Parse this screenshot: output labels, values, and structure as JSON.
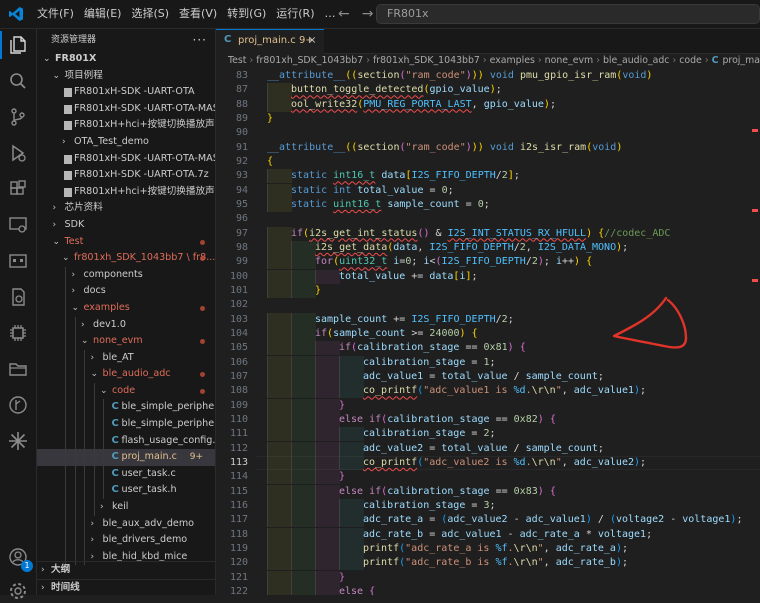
{
  "titlebar": {
    "menu": [
      "文件(F)",
      "编辑(E)",
      "选择(S)",
      "查看(V)",
      "转到(G)",
      "运行(R)",
      "…"
    ],
    "search_text": "FR801x"
  },
  "activity_bar": {
    "icons": [
      "explorer-icon",
      "search-icon",
      "source-control-icon",
      "run-debug-icon",
      "extensions-icon",
      "remote-explorer-icon",
      "terminal-icon",
      "testing-icon",
      "chip-icon",
      "folder-icon",
      "git-graph-icon",
      "sparkle-icon",
      "account-icon",
      "settings-icon"
    ],
    "badge": "1",
    "accent": "#0078d4"
  },
  "sidebar": {
    "title": "资源管理器",
    "more": "···",
    "tree": [
      {
        "label": "FR801X",
        "level": 0,
        "chev": "⌄",
        "bold": true
      },
      {
        "label": "项目例程",
        "level": 1,
        "chev": "⌄"
      },
      {
        "label": "FR801xH-SDK -UART-OTA",
        "level": 2,
        "icon": "file"
      },
      {
        "label": "FR801xH-SDK -UART-OTA-MAST...",
        "level": 2,
        "icon": "file"
      },
      {
        "label": "FR801xH+hci+按键切换播放声音",
        "level": 2,
        "icon": "file"
      },
      {
        "label": "OTA_Test_demo",
        "level": 2,
        "chev": "›"
      },
      {
        "label": "FR801xH-SDK -UART-OTA-MAST...",
        "level": 2,
        "icon": "file"
      },
      {
        "label": "FR801xH-SDK -UART-OTA.7z",
        "level": 2,
        "icon": "file"
      },
      {
        "label": "FR801xH+hci+按键切换播放声音...",
        "level": 2,
        "icon": "file"
      },
      {
        "label": "芯片资料",
        "level": 1,
        "chev": "›"
      },
      {
        "label": "SDK",
        "level": 1,
        "chev": "›"
      },
      {
        "label": "Test",
        "level": 1,
        "chev": "⌄",
        "color": "red",
        "dot": true
      },
      {
        "label": "fr801xh_SDK_1043bb7 \\ fr8...",
        "level": 2,
        "chev": "⌄",
        "color": "red",
        "dot": true
      },
      {
        "label": "components",
        "level": 3,
        "chev": "›"
      },
      {
        "label": "docs",
        "level": 3,
        "chev": "›"
      },
      {
        "label": "examples",
        "level": 3,
        "chev": "⌄",
        "color": "red",
        "dot": true
      },
      {
        "label": "dev1.0",
        "level": 4,
        "chev": "›"
      },
      {
        "label": "none_evm",
        "level": 4,
        "chev": "⌄",
        "color": "red",
        "dot": true
      },
      {
        "label": "ble_AT",
        "level": 5,
        "chev": "›"
      },
      {
        "label": "ble_audio_adc",
        "level": 5,
        "chev": "⌄",
        "color": "red",
        "dot": true
      },
      {
        "label": "code",
        "level": 6,
        "chev": "⌄",
        "color": "red",
        "dot": true
      },
      {
        "label": "ble_simple_peripheral.c",
        "level": 7,
        "icon": "c"
      },
      {
        "label": "ble_simple_peripheral.h",
        "level": 7,
        "icon": "c"
      },
      {
        "label": "flash_usage_config.h",
        "level": 7,
        "icon": "c"
      },
      {
        "label": "proj_main.c",
        "level": 7,
        "icon": "c",
        "color": "orange",
        "count": "9+",
        "selected": true
      },
      {
        "label": "user_task.c",
        "level": 7,
        "icon": "c"
      },
      {
        "label": "user_task.h",
        "level": 7,
        "icon": "c"
      },
      {
        "label": "keil",
        "level": 6,
        "chev": "›"
      },
      {
        "label": "ble_aux_adv_demo",
        "level": 5,
        "chev": "›"
      },
      {
        "label": "ble_drivers_demo",
        "level": 5,
        "chev": "›"
      },
      {
        "label": "ble_hid_kbd_mice",
        "level": 5,
        "chev": "›"
      }
    ],
    "footer": [
      {
        "label": "大纲",
        "chev": "›"
      },
      {
        "label": "时间线",
        "chev": "›"
      }
    ]
  },
  "tab": {
    "icon": "C",
    "label": "proj_main.c 9+",
    "close": "×"
  },
  "breadcrumb": [
    "Test",
    "fr801xh_SDK_1043bb7",
    "fr801xh_SDK_1043bb7",
    "examples",
    "none_evm",
    "ble_audio_adc",
    "code",
    "proj_main.c"
  ],
  "current_line": "113",
  "code_lines": [
    {
      "n": "83",
      "ind": 0,
      "html": "<span class='k'>__attribute__</span><span class='y'>((</span><span class='f'>section</span><span class='pu'>(</span><span class='s'>\"ram_code\"</span><span class='pu'>)</span><span class='y'>))</span> <span class='k'>void</span> <span class='f'>pmu_gpio_isr_ram</span><span class='y'>(</span><span class='k'>void</span><span class='y'>)</span>"
    },
    {
      "n": "87",
      "ind": 1,
      "html": "<span class='f sq'>button_toggle_detected</span><span class='y'>(</span><span class='v'>gpio_value</span><span class='y'>)</span><span class='p'>;</span>"
    },
    {
      "n": "88",
      "ind": 1,
      "html": "<span class='f sq'>ool_write32</span><span class='y'>(</span><span class='m sq'>PMU_REG_PORTA_LAST</span><span class='p'>, </span><span class='v'>gpio_value</span><span class='y'>)</span><span class='p'>;</span>"
    },
    {
      "n": "89",
      "ind": 0,
      "html": "<span class='y'>}</span>"
    },
    {
      "n": "90",
      "ind": 0,
      "html": ""
    },
    {
      "n": "91",
      "ind": 0,
      "html": "<span class='k'>__attribute__</span><span class='y'>((</span><span class='f'>section</span><span class='pu'>(</span><span class='s'>\"ram_code\"</span><span class='pu'>)</span><span class='y'>))</span> <span class='k'>void</span> <span class='f'>i2s_isr_ram</span><span class='y'>(</span><span class='k'>void</span><span class='y'>)</span>"
    },
    {
      "n": "92",
      "ind": 0,
      "html": "<span class='y'>{</span>"
    },
    {
      "n": "93",
      "ind": 1,
      "html": "<span class='k'>static</span> <span class='t sq'>int16_t</span> <span class='v'>data</span><span class='y'>[</span><span class='m'>I2S_FIFO_DEPTH</span><span class='p'>/</span><span class='n'>2</span><span class='y'>]</span><span class='p'>;</span>"
    },
    {
      "n": "94",
      "ind": 1,
      "html": "<span class='k'>static</span> <span class='k'>int</span> <span class='v'>total_value</span> <span class='p'>= </span><span class='n'>0</span><span class='p'>;</span>"
    },
    {
      "n": "95",
      "ind": 1,
      "html": "<span class='k'>static</span> <span class='t sq'>uint16_t</span> <span class='v'>sample_count</span> <span class='p'>= </span><span class='n'>0</span><span class='p'>;</span>"
    },
    {
      "n": "96",
      "ind": 0,
      "html": ""
    },
    {
      "n": "97",
      "ind": 1,
      "html": "<span class='c'>if</span><span class='y'>(</span><span class='f sq'>i2s_get_int_status</span><span class='pu'>()</span> <span class='p'>&amp;</span> <span class='m sq'>I2S_INT_STATUS_RX_HFULL</span><span class='y'>)</span> <span class='y'>{</span><span class='cm'>//codec_ADC</span>"
    },
    {
      "n": "98",
      "ind": 2,
      "html": "<span class='f sq'>i2s_get_data</span><span class='y'>(</span><span class='v'>data</span><span class='p'>, </span><span class='m'>I2S_FIFO_DEPTH</span><span class='p'>/</span><span class='n'>2</span><span class='p'>, </span><span class='m'>I2S_DATA_MONO</span><span class='y'>)</span><span class='p'>;</span>"
    },
    {
      "n": "99",
      "ind": 2,
      "html": "<span class='c'>for</span><span class='y'>(</span><span class='t sq'>uint32_t</span> <span class='v'>i</span><span class='p'>=</span><span class='n'>0</span><span class='p'>; </span><span class='v'>i</span><span class='p'>&lt;</span><span class='pu'>(</span><span class='m'>I2S_FIFO_DEPTH</span><span class='p'>/</span><span class='n'>2</span><span class='pu'>)</span><span class='p'>; </span><span class='v'>i</span><span class='p'>++</span><span class='y'>)</span> <span class='y'>{</span>"
    },
    {
      "n": "100",
      "ind": 3,
      "html": "<span class='v'>total_value</span> <span class='p'>+= </span><span class='v'>data</span><span class='y'>[</span><span class='v'>i</span><span class='y'>]</span><span class='p'>;</span>"
    },
    {
      "n": "101",
      "ind": 2,
      "html": "<span class='y'>}</span>"
    },
    {
      "n": "102",
      "ind": 0,
      "html": ""
    },
    {
      "n": "103",
      "ind": 2,
      "html": "<span class='v'>sample_count</span> <span class='p'>+= </span><span class='m'>I2S_FIFO_DEPTH</span><span class='p'>/</span><span class='n'>2</span><span class='p'>;</span>"
    },
    {
      "n": "104",
      "ind": 2,
      "html": "<span class='c'>if</span><span class='y'>(</span><span class='v'>sample_count</span> <span class='p'>&gt;= </span><span class='n'>24000</span><span class='y'>)</span> <span class='y'>{</span>"
    },
    {
      "n": "105",
      "ind": 3,
      "html": "<span class='c'>if</span><span class='pu'>(</span><span class='v'>calibration_stage</span> <span class='p'>== </span><span class='n'>0x81</span><span class='pu'>)</span> <span class='pu'>{</span>"
    },
    {
      "n": "106",
      "ind": 4,
      "html": "<span class='v'>calibration_stage</span> <span class='p'>= </span><span class='n'>1</span><span class='p'>;</span>"
    },
    {
      "n": "107",
      "ind": 4,
      "html": "<span class='v'>adc_value1</span> <span class='p'>= </span><span class='v'>total_value</span> <span class='p'>/ </span><span class='v'>sample_count</span><span class='p'>;</span>"
    },
    {
      "n": "108",
      "ind": 4,
      "html": "<span class='f sq'>co_printf</span><span class='bl'>(</span><span class='s'>\"adc_value1 is </span><span class='m'>%d</span><span class='s'>.</span><span class='f'>\\r\\n</span><span class='s'>\"</span><span class='p'>, </span><span class='v'>adc_value1</span><span class='bl'>)</span><span class='p'>;</span>"
    },
    {
      "n": "109",
      "ind": 3,
      "html": "<span class='pu'>}</span>"
    },
    {
      "n": "110",
      "ind": 3,
      "html": "<span class='c'>else</span> <span class='c'>if</span><span class='pu'>(</span><span class='v'>calibration_stage</span> <span class='p'>== </span><span class='n'>0x82</span><span class='pu'>)</span> <span class='pu'>{</span>"
    },
    {
      "n": "111",
      "ind": 4,
      "html": "<span class='v'>calibration_stage</span> <span class='p'>= </span><span class='n'>2</span><span class='p'>;</span>"
    },
    {
      "n": "112",
      "ind": 4,
      "html": "<span class='v'>adc_value2</span> <span class='p'>= </span><span class='v'>total_value</span> <span class='p'>/ </span><span class='v'>sample_count</span><span class='p'>;</span>"
    },
    {
      "n": "113",
      "ind": 4,
      "html": "<span class='f sq'>co_printf</span><span class='bl'>(</span><span class='s'>\"adc_value2 is </span><span class='m'>%d</span><span class='s'>.</span><span class='f'>\\r\\n</span><span class='s'>\"</span><span class='p'>, </span><span class='v'>adc_value2</span><span class='bl'>)</span><span class='p'>;</span>"
    },
    {
      "n": "114",
      "ind": 3,
      "html": "<span class='pu'>}</span>"
    },
    {
      "n": "115",
      "ind": 3,
      "html": "<span class='c'>else</span> <span class='c'>if</span><span class='pu'>(</span><span class='v'>calibration_stage</span> <span class='p'>== </span><span class='n'>0x83</span><span class='pu'>)</span> <span class='pu'>{</span>"
    },
    {
      "n": "116",
      "ind": 4,
      "html": "<span class='v'>calibration_stage</span> <span class='p'>= </span><span class='n'>3</span><span class='p'>;</span>"
    },
    {
      "n": "117",
      "ind": 4,
      "html": "<span class='v'>adc_rate_a</span> <span class='p'>= </span><span class='bl'>(</span><span class='v'>adc_value2</span> <span class='p'>- </span><span class='v'>adc_value1</span><span class='bl'>)</span> <span class='p'>/ </span><span class='bl'>(</span><span class='v'>voltage2</span> <span class='p'>- </span><span class='v'>voltage1</span><span class='bl'>)</span><span class='p'>;</span>"
    },
    {
      "n": "118",
      "ind": 4,
      "html": "<span class='v'>adc_rate_b</span> <span class='p'>= </span><span class='v'>adc_value1</span> <span class='p'>- </span><span class='v'>adc_rate_a</span> <span class='p'>* </span><span class='v'>voltage1</span><span class='p'>;</span>"
    },
    {
      "n": "119",
      "ind": 4,
      "html": "<span class='f'>printf</span><span class='bl'>(</span><span class='s'>\"adc_rate_a is </span><span class='m'>%f</span><span class='s'>.</span><span class='f'>\\r\\n</span><span class='s'>\"</span><span class='p'>, </span><span class='v'>adc_rate_a</span><span class='bl'>)</span><span class='p'>;</span>"
    },
    {
      "n": "120",
      "ind": 4,
      "html": "<span class='f'>printf</span><span class='bl'>(</span><span class='s'>\"adc_rate_b is </span><span class='m'>%f</span><span class='s'>.</span><span class='f'>\\r\\n</span><span class='s'>\"</span><span class='p'>, </span><span class='v'>adc_rate_b</span><span class='bl'>)</span><span class='p'>;</span>"
    },
    {
      "n": "121",
      "ind": 3,
      "html": "<span class='pu'>}</span>"
    },
    {
      "n": "122",
      "ind": 3,
      "html": "<span class='c'>else</span> <span class='pu'>{</span>"
    }
  ],
  "annotation": {
    "color": "#e0332a"
  }
}
